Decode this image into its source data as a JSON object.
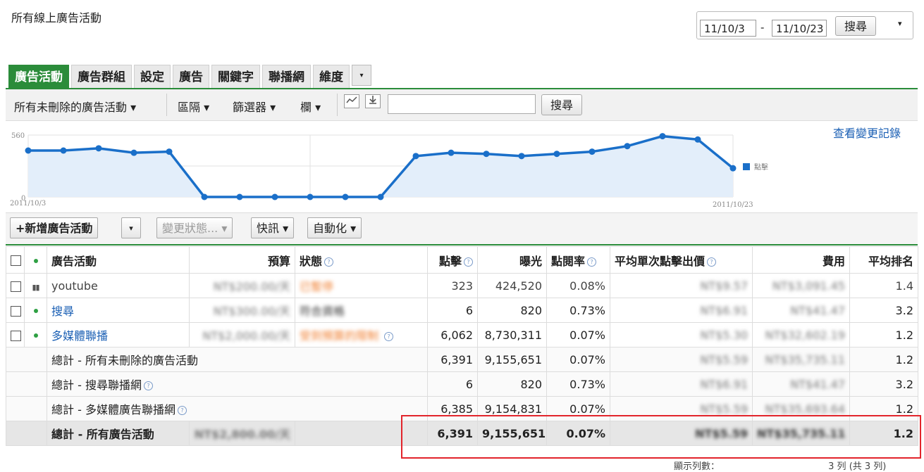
{
  "page_title": "所有線上廣告活動",
  "date_range": {
    "start": "11/10/3",
    "separator": "-",
    "end": "11/10/23",
    "search_label": "搜尋",
    "dropdown": "▾"
  },
  "tabs": [
    {
      "label": "廣告活動",
      "active": true
    },
    {
      "label": "廣告群組"
    },
    {
      "label": "設定"
    },
    {
      "label": "廣告"
    },
    {
      "label": "關鍵字"
    },
    {
      "label": "聯播網"
    },
    {
      "label": "維度"
    }
  ],
  "toolbar": {
    "filter_label": "所有未刪除的廣告活動 ▾",
    "segment_label": "區隔 ▾",
    "filters_label": "篩選器 ▾",
    "columns_label": "欄 ▾",
    "search_label": "搜尋",
    "search_value": ""
  },
  "change_history_link": "查看變更記錄",
  "chart_data": {
    "type": "line",
    "x_start_label": "2011/10/3",
    "x_end_label": "2011/10/23",
    "y_max_label": "560",
    "y_min_label": "0",
    "ylim": [
      0,
      560
    ],
    "series": [
      {
        "name": "點擊",
        "color": "#1a6fc9",
        "values": [
          420,
          420,
          440,
          400,
          410,
          0,
          0,
          0,
          0,
          0,
          0,
          370,
          400,
          390,
          370,
          390,
          410,
          460,
          550,
          520,
          260
        ]
      }
    ]
  },
  "actions": {
    "new_campaign": "+新增廣告活動",
    "new_campaign_dropdown": "▾",
    "change_status": "變更狀態... ▾",
    "alerts": "快訊 ▾",
    "automate": "自動化 ▾"
  },
  "table": {
    "headers": {
      "campaign": "廣告活動",
      "budget": "預算",
      "status": "狀態",
      "clicks": "點擊",
      "impressions": "曝光",
      "ctr": "點閱率",
      "avg_cpc": "平均單次點擊出價",
      "cost": "費用",
      "avg_pos": "平均排名"
    },
    "rows": [
      {
        "name": "youtube",
        "budget": "NT$200.00/天",
        "status": "已暫停",
        "clicks": "323",
        "impressions": "424,520",
        "ctr": "0.08%",
        "cpc": "NT$9.57",
        "cost": "NT$3,091.45",
        "pos": "1.4"
      },
      {
        "name": "搜尋",
        "budget": "NT$300.00/天",
        "status": "符合資格",
        "clicks": "6",
        "impressions": "820",
        "ctr": "0.73%",
        "cpc": "NT$6.91",
        "cost": "NT$41.47",
        "pos": "3.2"
      },
      {
        "name": "多媒體聯播",
        "budget": "NT$2,000.00/天",
        "status": "受到預算的限制",
        "clicks": "6,062",
        "impressions": "8,730,311",
        "ctr": "0.07%",
        "cpc": "NT$5.30",
        "cost": "NT$32,602.19",
        "pos": "1.2"
      }
    ],
    "totals": [
      {
        "label": "總計 - 所有未刪除的廣告活動",
        "clicks": "6,391",
        "impressions": "9,155,651",
        "ctr": "0.07%",
        "cpc": "NT$5.59",
        "cost": "NT$35,735.11",
        "pos": "1.2"
      },
      {
        "label": "總計 - 搜尋聯播網",
        "clicks": "6",
        "impressions": "820",
        "ctr": "0.73%",
        "cpc": "NT$6.91",
        "cost": "NT$41.47",
        "pos": "3.2"
      },
      {
        "label": "總計 - 多媒體廣告聯播網",
        "clicks": "6,385",
        "impressions": "9,154,831",
        "ctr": "0.07%",
        "cpc": "NT$5.59",
        "cost": "NT$35,693.64",
        "pos": "1.2"
      }
    ],
    "grand_total": {
      "label": "總計 - 所有廣告活動",
      "budget": "NT$2,800.00/天",
      "clicks": "6,391",
      "impressions": "9,155,651",
      "ctr": "0.07%",
      "cpc": "NT$5.59",
      "cost": "NT$35,735.11",
      "pos": "1.2"
    }
  },
  "footer": {
    "rows_label": "顯示列數：",
    "range": "3 列 (共 3 列)"
  }
}
